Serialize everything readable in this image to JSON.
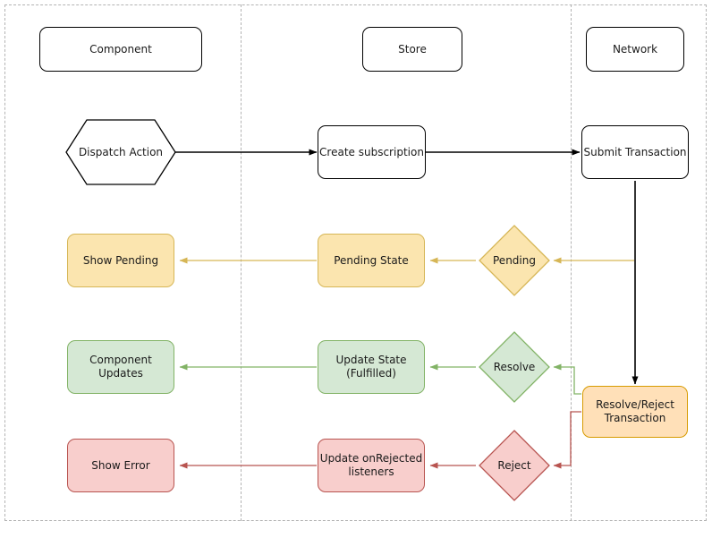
{
  "diagram": {
    "title": "Redux async transaction flow swimlane diagram",
    "type": "swimlane-flowchart",
    "lanes": [
      {
        "id": "component",
        "label": "Component"
      },
      {
        "id": "store",
        "label": "Store"
      },
      {
        "id": "network",
        "label": "Network"
      }
    ],
    "colors": {
      "white_fill": "#ffffff",
      "white_stroke": "#000000",
      "yellow_fill": "#fbe5af",
      "yellow_stroke": "#d6b656",
      "green_fill": "#d5e8d4",
      "green_stroke": "#82b366",
      "red_fill": "#f8cecc",
      "red_stroke": "#b85450",
      "orange_fill": "#ffe0b8",
      "orange_stroke": "#d79b00",
      "lane_divider": "#b3b3b3"
    },
    "nodes": [
      {
        "id": "dispatch_action",
        "label": "Dispatch Action",
        "shape": "hexagon",
        "color": "white"
      },
      {
        "id": "create_subscription",
        "label": "Create subscription",
        "shape": "rounded-rect",
        "color": "white"
      },
      {
        "id": "submit_transaction",
        "label": "Submit Transaction",
        "shape": "rounded-rect",
        "color": "white"
      },
      {
        "id": "show_pending",
        "label": "Show Pending",
        "shape": "rounded-rect",
        "color": "yellow"
      },
      {
        "id": "pending_state",
        "label": "Pending State",
        "shape": "rounded-rect",
        "color": "yellow"
      },
      {
        "id": "pending",
        "label": "Pending",
        "shape": "diamond",
        "color": "yellow"
      },
      {
        "id": "component_updates",
        "label": "Component Updates",
        "shape": "rounded-rect",
        "color": "green"
      },
      {
        "id": "update_state",
        "label": "Update State\n(Fulfilled)",
        "shape": "rounded-rect",
        "color": "green"
      },
      {
        "id": "resolve",
        "label": "Resolve",
        "shape": "diamond",
        "color": "green"
      },
      {
        "id": "show_error",
        "label": "Show Error",
        "shape": "rounded-rect",
        "color": "red"
      },
      {
        "id": "update_onrejected",
        "label": "Update onRejected\nlisteners",
        "shape": "rounded-rect",
        "color": "red"
      },
      {
        "id": "reject",
        "label": "Reject",
        "shape": "diamond",
        "color": "red"
      },
      {
        "id": "resolve_reject_tx",
        "label": "Resolve/Reject\nTransaction",
        "shape": "rounded-rect",
        "color": "orange"
      }
    ],
    "node_labels": {
      "dispatch_action": "Dispatch Action",
      "create_subscription": "Create subscription",
      "submit_transaction": "Submit Transaction",
      "show_pending": "Show Pending",
      "pending_state": "Pending State",
      "pending": "Pending",
      "component_updates": "Component Updates",
      "update_state_line1": "Update State",
      "update_state_line2": "(Fulfilled)",
      "resolve": "Resolve",
      "show_error": "Show Error",
      "update_onrejected_line1": "Update onRejected",
      "update_onrejected_line2": "listeners",
      "reject": "Reject",
      "resolve_reject_tx_line1": "Resolve/Reject",
      "resolve_reject_tx_line2": "Transaction"
    },
    "edges": [
      {
        "from": "dispatch_action",
        "to": "create_subscription",
        "color": "#000000"
      },
      {
        "from": "create_subscription",
        "to": "submit_transaction",
        "color": "#000000"
      },
      {
        "from": "submit_transaction",
        "to": "resolve_reject_tx",
        "color": "#000000"
      },
      {
        "from": "network_bus",
        "to": "pending",
        "color": "#d6b656"
      },
      {
        "from": "pending",
        "to": "pending_state",
        "color": "#d6b656"
      },
      {
        "from": "pending_state",
        "to": "show_pending",
        "color": "#d6b656"
      },
      {
        "from": "resolve_reject_tx",
        "to": "resolve",
        "color": "#82b366"
      },
      {
        "from": "resolve",
        "to": "update_state",
        "color": "#82b366"
      },
      {
        "from": "update_state",
        "to": "component_updates",
        "color": "#82b366"
      },
      {
        "from": "resolve_reject_tx",
        "to": "reject",
        "color": "#b85450"
      },
      {
        "from": "reject",
        "to": "update_onrejected",
        "color": "#b85450"
      },
      {
        "from": "update_onrejected",
        "to": "show_error",
        "color": "#b85450"
      }
    ]
  }
}
